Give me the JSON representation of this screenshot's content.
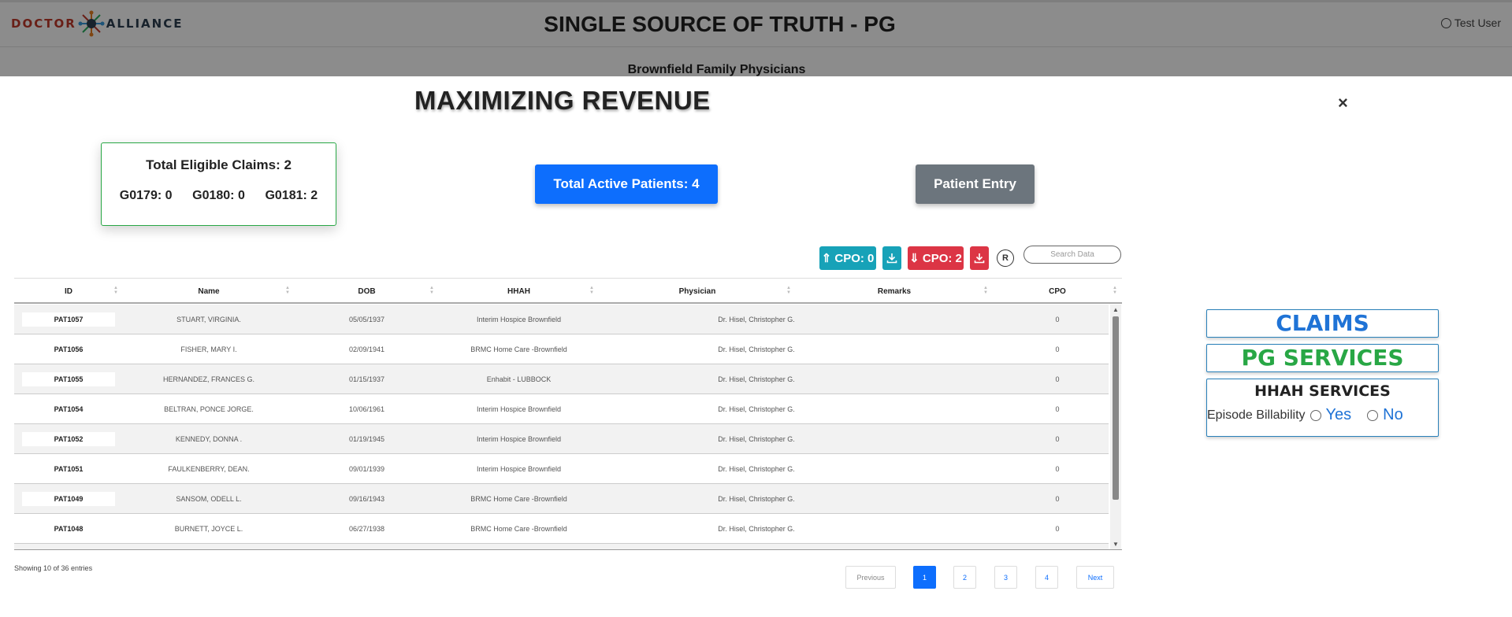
{
  "header": {
    "logo_left": "DOCTOR",
    "logo_right": "ALLIANCE",
    "title": "SINGLE SOURCE OF TRUTH - PG",
    "user": "Test User",
    "subtitle": "Brownfield Family Physicians"
  },
  "modal": {
    "title": "MAXIMIZING REVENUE",
    "close": "×",
    "eligible": {
      "title": "Total Eligible Claims: 2",
      "codes": [
        "G0179: 0",
        "G0180: 0",
        "G0181: 2"
      ]
    },
    "active_patients": "Total Active Patients: 4",
    "patient_entry": "Patient Entry"
  },
  "toolbar": {
    "cpo_up": "⇑ CPO: 0",
    "cpo_down": "⇓ CPO: 2",
    "reset": "R",
    "search_placeholder": "Search Data"
  },
  "table": {
    "columns": [
      "ID",
      "Name",
      "DOB",
      "HHAH",
      "Physician",
      "Remarks",
      "CPO"
    ],
    "rows": [
      [
        "PAT1057",
        "STUART, VIRGINIA.",
        "05/05/1937",
        "Interim Hospice Brownfield",
        "Dr. Hisel, Christopher G.",
        "0"
      ],
      [
        "PAT1056",
        "FISHER, MARY I.",
        "02/09/1941",
        "BRMC Home Care -Brownfield",
        "Dr. Hisel, Christopher G.",
        "0"
      ],
      [
        "PAT1055",
        "HERNANDEZ, FRANCES G.",
        "01/15/1937",
        "Enhabit - LUBBOCK",
        "Dr. Hisel, Christopher G.",
        "0"
      ],
      [
        "PAT1054",
        "BELTRAN, PONCE JORGE.",
        "10/06/1961",
        "Interim Hospice Brownfield",
        "Dr. Hisel, Christopher G.",
        "0"
      ],
      [
        "PAT1052",
        "KENNEDY, DONNA .",
        "01/19/1945",
        "Interim Hospice Brownfield",
        "Dr. Hisel, Christopher G.",
        "0"
      ],
      [
        "PAT1051",
        "FAULKENBERRY, DEAN.",
        "09/01/1939",
        "Interim Hospice Brownfield",
        "Dr. Hisel, Christopher G.",
        "0"
      ],
      [
        "PAT1049",
        "SANSOM, ODELL L.",
        "09/16/1943",
        "BRMC Home Care -Brownfield",
        "Dr. Hisel, Christopher G.",
        "0"
      ],
      [
        "PAT1048",
        "BURNETT, JOYCE L.",
        "06/27/1938",
        "BRMC Home Care -Brownfield",
        "Dr. Hisel, Christopher G.",
        "0"
      ]
    ],
    "info": "Showing 10 of 36 entries",
    "pagination": [
      "Previous",
      "1",
      "2",
      "3",
      "4",
      "Next"
    ],
    "active_page": "1"
  },
  "side": {
    "claims": "CLAIMS",
    "pg_services": "PG SERVICES",
    "hhah_title": "HHAH SERVICES",
    "episode_label": "Episode Billability",
    "yes": "Yes",
    "no": "No"
  },
  "colors": {
    "primary": "#0d6efd",
    "success": "#28a745",
    "info": "#17a2b8",
    "danger": "#dc3545",
    "secondary": "#6c757d"
  }
}
